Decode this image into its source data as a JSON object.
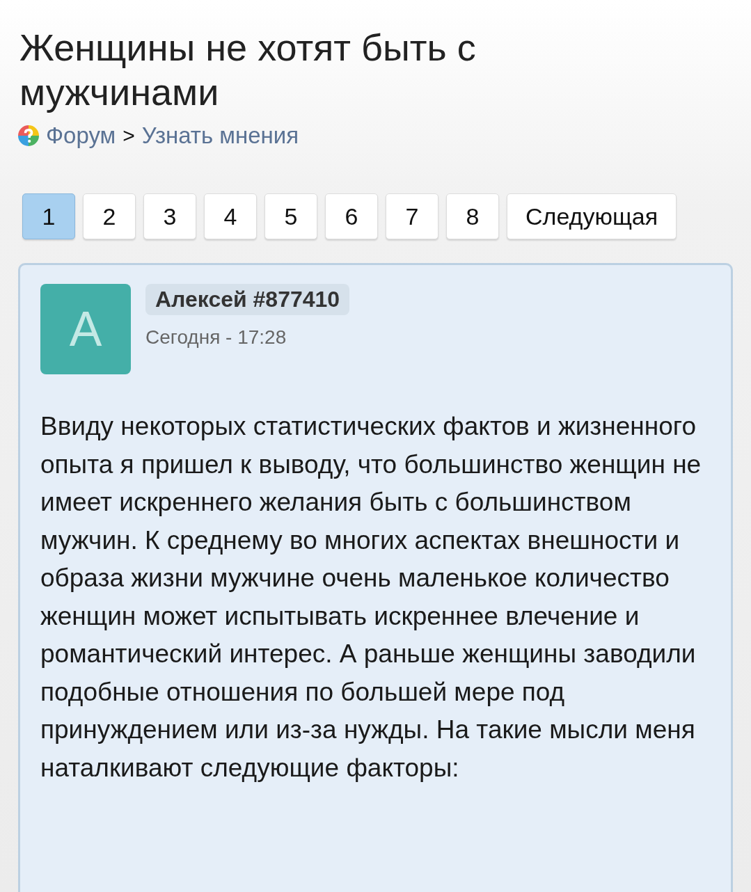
{
  "title": "Женщины не хотят быть с мужчинами",
  "breadcrumb": {
    "items": [
      {
        "label": "Форум"
      },
      {
        "label": "Узнать мнения"
      }
    ],
    "separator": ">"
  },
  "pagination": {
    "pages": [
      {
        "label": "1",
        "selected": true
      },
      {
        "label": "2",
        "selected": false
      },
      {
        "label": "3",
        "selected": false
      },
      {
        "label": "4",
        "selected": false
      },
      {
        "label": "5",
        "selected": false
      },
      {
        "label": "6",
        "selected": false
      },
      {
        "label": "7",
        "selected": false
      },
      {
        "label": "8",
        "selected": false
      }
    ],
    "next": "Следующая"
  },
  "post": {
    "avatar_letter": "А",
    "author": "Алексей #877410",
    "time": "Сегодня - 17:28",
    "body": "Ввиду некоторых статистических фактов и жизненного опыта я пришел к выводу, что большинство женщин не имеет искреннего желания быть с большинством мужчин. К среднему во многих аспектах внешности и образа жизни мужчине очень маленькое количество женщин может испытывать искреннее влечение и романтический интерес. А раньше женщины заводили подобные отношения по большей мере под принуждением или из-за нужды. На такие мысли меня наталкивают следующие факторы:"
  }
}
